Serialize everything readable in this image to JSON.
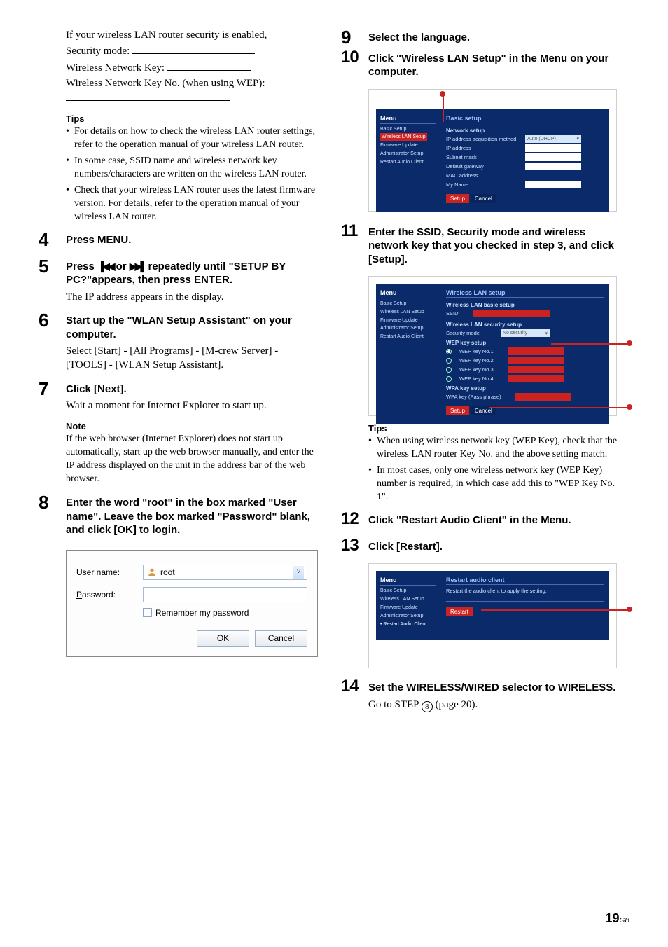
{
  "left": {
    "intro": "If your wireless LAN router security is enabled,",
    "blank1_label": "Security mode:",
    "blank2_label": "Wireless Network Key:",
    "blank3_label": "Wireless Network Key No. (when using WEP):",
    "tips_head": "Tips",
    "tips": [
      "For details on how to check the wireless LAN router settings, refer to the operation manual of your wireless LAN router.",
      "In some case, SSID name and wireless network key numbers/characters are written on the wireless LAN router.",
      "Check that your wireless LAN router uses the latest firmware version. For details, refer to the operation manual of your wireless LAN router."
    ],
    "step4_title": "Press MENU.",
    "step5_title_a": "Press ",
    "step5_title_b": " or ",
    "step5_title_c": " repeatedly until \"SETUP BY PC?\"appears, then press ENTER.",
    "step5_desc": "The IP address appears in the display.",
    "step6_title": "Start up the \"WLAN Setup Assistant\" on your computer.",
    "step6_desc": "Select [Start] - [All Programs] - [M-crew Server] - [TOOLS] - [WLAN Setup Assistant].",
    "step7_title": "Click [Next].",
    "step7_desc": "Wait a moment for Internet Explorer to start up.",
    "note_head": "Note",
    "note_text": "If the web browser (Internet Explorer) does not start up automatically, start up the web browser manually, and enter the IP address displayed on the unit in the address bar of the web browser.",
    "step8_title": "Enter the word \"root\" in the box marked \"User name\". Leave the box marked \"Password\" blank, and click [OK] to login.",
    "login": {
      "user_label_u": "U",
      "user_label_rest": "ser name:",
      "pass_label_u": "P",
      "pass_label_rest": "assword:",
      "user_value": "root",
      "remember_u": "R",
      "remember_rest": "emember my password",
      "ok": "OK",
      "cancel": "Cancel"
    }
  },
  "right": {
    "step9_title": "Select the language.",
    "step10_title": "Click \"Wireless LAN Setup\" in the Menu on your computer.",
    "shot1": {
      "menu_hdr": "Menu",
      "mi1": "Basic Setup",
      "mi2": "Wireless LAN Setup",
      "mi3": "Firmware Update",
      "mi4": "Administrator Setup",
      "mi5": "Restart Audio Client",
      "pane_hdr": "Basic setup",
      "sect": "Network setup",
      "r1l": "IP address acquisition method",
      "r1v": "Auto (DHCP)",
      "r2l": "IP address",
      "r3l": "Subnet mask",
      "r4l": "Default gateway",
      "r5l": "MAC address",
      "r6l": "My Name",
      "btn_setup": "Setup",
      "btn_cancel": "Cancel"
    },
    "step11_title": "Enter the SSID, Security mode and wireless network key that you checked in step 3, and click [Setup].",
    "shot2": {
      "menu_hdr": "Menu",
      "mi1": "Basic Setup",
      "mi2": "Wireless LAN Setup",
      "mi3": "Firmware Update",
      "mi4": "Administrator Setup",
      "mi5": "Restart Audio Client",
      "pane_hdr": "Wireless LAN setup",
      "sect1": "Wireless LAN basic setup",
      "ssid_l": "SSID",
      "sect2": "Wireless LAN security setup",
      "sec_l": "Security mode",
      "sec_v": "No security",
      "wep_head": "WEP key setup",
      "k1": "WEP key No.1",
      "k2": "WEP key No.2",
      "k3": "WEP key No.3",
      "k4": "WEP key No.4",
      "wpa_head": "WPA key setup",
      "wpa_l": "WPA key (Pass phrase)",
      "btn_setup": "Setup",
      "btn_cancel": "Cancel"
    },
    "tips_head": "Tips",
    "tips": [
      "When using wireless network key (WEP Key), check that the wireless LAN router Key No. and the above setting match.",
      "In most cases, only one wireless network key (WEP Key) number is required, in which case add this to \"WEP Key No. 1\"."
    ],
    "step12_title": "Click \"Restart Audio Client\" in the Menu.",
    "step13_title": "Click [Restart].",
    "shot3": {
      "menu_hdr": "Menu",
      "mi1": "Basic Setup",
      "mi2": "Wireless LAN Setup",
      "mi3": "Firmware Update",
      "mi4": "Administrator Setup",
      "mi5": "Restart Audio Client",
      "pane_hdr": "Restart audio client",
      "desc": "Restart the audio client to apply the setting.",
      "btn_restart": "Restart"
    },
    "step14_title": "Set the WIRELESS/WIRED selector to WIRELESS.",
    "step14_desc_a": "Go to STEP ",
    "step14_desc_b": "8",
    "step14_desc_c": " (page 20)."
  },
  "footer": {
    "num": "19",
    "gb": "GB"
  }
}
